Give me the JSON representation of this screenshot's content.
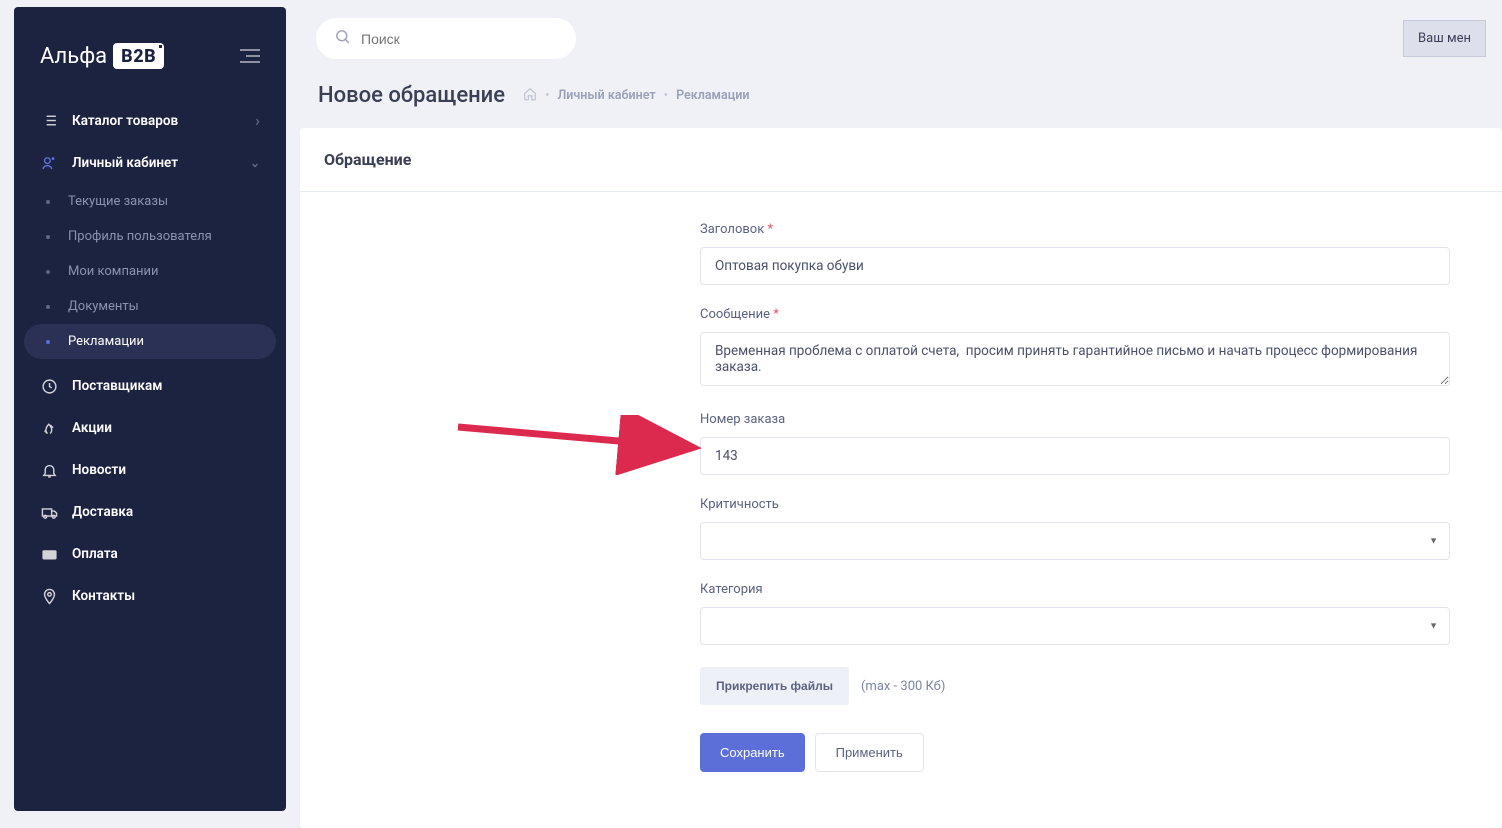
{
  "logo": {
    "text": "Альфа",
    "badge": "B2B"
  },
  "search": {
    "placeholder": "Поиск"
  },
  "user_menu": {
    "label": "Ваш мен"
  },
  "page": {
    "title": "Новое обращение",
    "breadcrumb": {
      "item1": "Личный кабинет",
      "item2": "Рекламации"
    }
  },
  "sidebar": {
    "items": [
      {
        "label": "Каталог товаров"
      },
      {
        "label": "Личный кабинет"
      },
      {
        "label": "Поставщикам"
      },
      {
        "label": "Акции"
      },
      {
        "label": "Новости"
      },
      {
        "label": "Доставка"
      },
      {
        "label": "Оплата"
      },
      {
        "label": "Контакты"
      }
    ],
    "submenu": [
      {
        "label": "Текущие заказы"
      },
      {
        "label": "Профиль пользователя"
      },
      {
        "label": "Мои компании"
      },
      {
        "label": "Документы"
      },
      {
        "label": "Рекламации"
      }
    ]
  },
  "card": {
    "title": "Обращение"
  },
  "form": {
    "title_label": "Заголовок",
    "title_value": "Оптовая покупка обуви",
    "message_label": "Сообщение",
    "message_value": "Временная проблема с оплатой счета,  просим принять гарантийное письмо и начать процесс формирования заказа.",
    "order_label": "Номер заказа",
    "order_value": "143",
    "priority_label": "Критичность",
    "priority_value": "",
    "category_label": "Категория",
    "category_value": "",
    "attach_label": "Прикрепить файлы",
    "attach_hint": "(max - 300 Кб)",
    "save_label": "Сохранить",
    "apply_label": "Применить"
  }
}
